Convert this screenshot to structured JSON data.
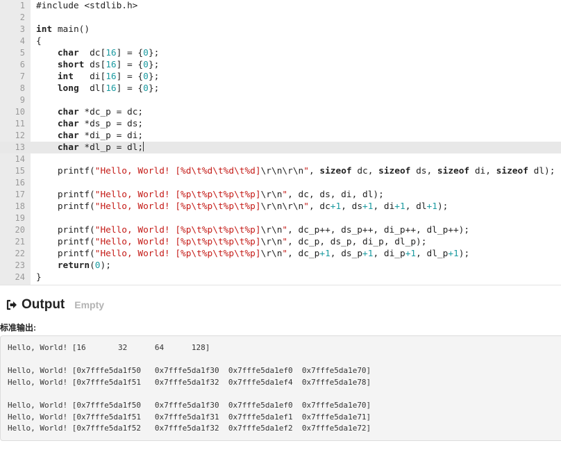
{
  "editor": {
    "active_line": 13,
    "lines": [
      [
        {
          "t": "#include <stdlib.h>",
          "c": ""
        }
      ],
      [],
      [
        {
          "t": "int",
          "c": "kw"
        },
        {
          "t": " main()",
          "c": ""
        }
      ],
      [
        {
          "t": "{",
          "c": ""
        }
      ],
      [
        {
          "t": "    ",
          "c": ""
        },
        {
          "t": "char",
          "c": "kw"
        },
        {
          "t": "  dc[",
          "c": ""
        },
        {
          "t": "16",
          "c": "num"
        },
        {
          "t": "] = {",
          "c": ""
        },
        {
          "t": "0",
          "c": "num"
        },
        {
          "t": "};",
          "c": ""
        }
      ],
      [
        {
          "t": "    ",
          "c": ""
        },
        {
          "t": "short",
          "c": "kw"
        },
        {
          "t": " ds[",
          "c": ""
        },
        {
          "t": "16",
          "c": "num"
        },
        {
          "t": "] = {",
          "c": ""
        },
        {
          "t": "0",
          "c": "num"
        },
        {
          "t": "};",
          "c": ""
        }
      ],
      [
        {
          "t": "    ",
          "c": ""
        },
        {
          "t": "int",
          "c": "kw"
        },
        {
          "t": "   di[",
          "c": ""
        },
        {
          "t": "16",
          "c": "num"
        },
        {
          "t": "] = {",
          "c": ""
        },
        {
          "t": "0",
          "c": "num"
        },
        {
          "t": "};",
          "c": ""
        }
      ],
      [
        {
          "t": "    ",
          "c": ""
        },
        {
          "t": "long",
          "c": "kw"
        },
        {
          "t": "  dl[",
          "c": ""
        },
        {
          "t": "16",
          "c": "num"
        },
        {
          "t": "] = {",
          "c": ""
        },
        {
          "t": "0",
          "c": "num"
        },
        {
          "t": "};",
          "c": ""
        }
      ],
      [],
      [
        {
          "t": "    ",
          "c": ""
        },
        {
          "t": "char",
          "c": "kw"
        },
        {
          "t": " *dc_p = dc;",
          "c": ""
        }
      ],
      [
        {
          "t": "    ",
          "c": ""
        },
        {
          "t": "char",
          "c": "kw"
        },
        {
          "t": " *ds_p = ds;",
          "c": ""
        }
      ],
      [
        {
          "t": "    ",
          "c": ""
        },
        {
          "t": "char",
          "c": "kw"
        },
        {
          "t": " *di_p = di;",
          "c": ""
        }
      ],
      [
        {
          "t": "    ",
          "c": ""
        },
        {
          "t": "char",
          "c": "kw"
        },
        {
          "t": " *dl_p = dl;",
          "c": ""
        },
        {
          "t": "",
          "c": "cursor"
        }
      ],
      [],
      [
        {
          "t": "    printf(",
          "c": ""
        },
        {
          "t": "\"Hello, World! [%d\\t%d\\t%d\\t%d]",
          "c": "str"
        },
        {
          "t": "\\r\\n\\r\\n",
          "c": "esc"
        },
        {
          "t": "\"",
          "c": "str"
        },
        {
          "t": ", ",
          "c": ""
        },
        {
          "t": "sizeof",
          "c": "kw"
        },
        {
          "t": " dc, ",
          "c": ""
        },
        {
          "t": "sizeof",
          "c": "kw"
        },
        {
          "t": " ds, ",
          "c": ""
        },
        {
          "t": "sizeof",
          "c": "kw"
        },
        {
          "t": " di, ",
          "c": ""
        },
        {
          "t": "sizeof",
          "c": "kw"
        },
        {
          "t": " dl);",
          "c": ""
        }
      ],
      [],
      [
        {
          "t": "    printf(",
          "c": ""
        },
        {
          "t": "\"Hello, World! [%p\\t%p\\t%p\\t%p]",
          "c": "str"
        },
        {
          "t": "\\r\\n",
          "c": "esc"
        },
        {
          "t": "\"",
          "c": "str"
        },
        {
          "t": ", dc, ds, di, dl);",
          "c": ""
        }
      ],
      [
        {
          "t": "    printf(",
          "c": ""
        },
        {
          "t": "\"Hello, World! [%p\\t%p\\t%p\\t%p]",
          "c": "str"
        },
        {
          "t": "\\r\\n\\r\\n",
          "c": "esc"
        },
        {
          "t": "\"",
          "c": "str"
        },
        {
          "t": ", dc",
          "c": ""
        },
        {
          "t": "+1",
          "c": "num"
        },
        {
          "t": ", ds",
          "c": ""
        },
        {
          "t": "+1",
          "c": "num"
        },
        {
          "t": ", di",
          "c": ""
        },
        {
          "t": "+1",
          "c": "num"
        },
        {
          "t": ", dl",
          "c": ""
        },
        {
          "t": "+1",
          "c": "num"
        },
        {
          "t": ");",
          "c": ""
        }
      ],
      [],
      [
        {
          "t": "    printf(",
          "c": ""
        },
        {
          "t": "\"Hello, World! [%p\\t%p\\t%p\\t%p]",
          "c": "str"
        },
        {
          "t": "\\r\\n",
          "c": "esc"
        },
        {
          "t": "\"",
          "c": "str"
        },
        {
          "t": ", dc_p++, ds_p++, di_p++, dl_p++);",
          "c": ""
        }
      ],
      [
        {
          "t": "    printf(",
          "c": ""
        },
        {
          "t": "\"Hello, World! [%p\\t%p\\t%p\\t%p]",
          "c": "str"
        },
        {
          "t": "\\r\\n",
          "c": "esc"
        },
        {
          "t": "\"",
          "c": "str"
        },
        {
          "t": ", dc_p, ds_p, di_p, dl_p);",
          "c": ""
        }
      ],
      [
        {
          "t": "    printf(",
          "c": ""
        },
        {
          "t": "\"Hello, World! [%p\\t%p\\t%p\\t%p]",
          "c": "str"
        },
        {
          "t": "\\r\\n",
          "c": "esc"
        },
        {
          "t": "\"",
          "c": "str"
        },
        {
          "t": ", dc_p",
          "c": ""
        },
        {
          "t": "+1",
          "c": "num"
        },
        {
          "t": ", ds_p",
          "c": ""
        },
        {
          "t": "+1",
          "c": "num"
        },
        {
          "t": ", di_p",
          "c": ""
        },
        {
          "t": "+1",
          "c": "num"
        },
        {
          "t": ", dl_p",
          "c": ""
        },
        {
          "t": "+1",
          "c": "num"
        },
        {
          "t": ");",
          "c": ""
        }
      ],
      [
        {
          "t": "    ",
          "c": ""
        },
        {
          "t": "return",
          "c": "kw"
        },
        {
          "t": "(",
          "c": ""
        },
        {
          "t": "0",
          "c": "num"
        },
        {
          "t": ");",
          "c": ""
        }
      ],
      [
        {
          "t": "}",
          "c": ""
        }
      ]
    ]
  },
  "output": {
    "title": "Output",
    "status": "Empty",
    "icon": "sign-out-icon",
    "stdout_label": "标准输出:",
    "stdout_lines": [
      "Hello, World! [16       32      64      128]",
      "",
      "Hello, World! [0x7fffe5da1f50   0x7fffe5da1f30  0x7fffe5da1ef0  0x7fffe5da1e70]",
      "Hello, World! [0x7fffe5da1f51   0x7fffe5da1f32  0x7fffe5da1ef4  0x7fffe5da1e78]",
      "",
      "Hello, World! [0x7fffe5da1f50   0x7fffe5da1f30  0x7fffe5da1ef0  0x7fffe5da1e70]",
      "Hello, World! [0x7fffe5da1f51   0x7fffe5da1f31  0x7fffe5da1ef1  0x7fffe5da1e71]",
      "Hello, World! [0x7fffe5da1f52   0x7fffe5da1f32  0x7fffe5da1ef2  0x7fffe5da1e72]"
    ]
  },
  "colors": {
    "keyword": "#222222",
    "string": "#c41a16",
    "number": "#1a9aa0",
    "gutter_bg": "#ebebeb",
    "output_bg": "#f4f4f4"
  }
}
